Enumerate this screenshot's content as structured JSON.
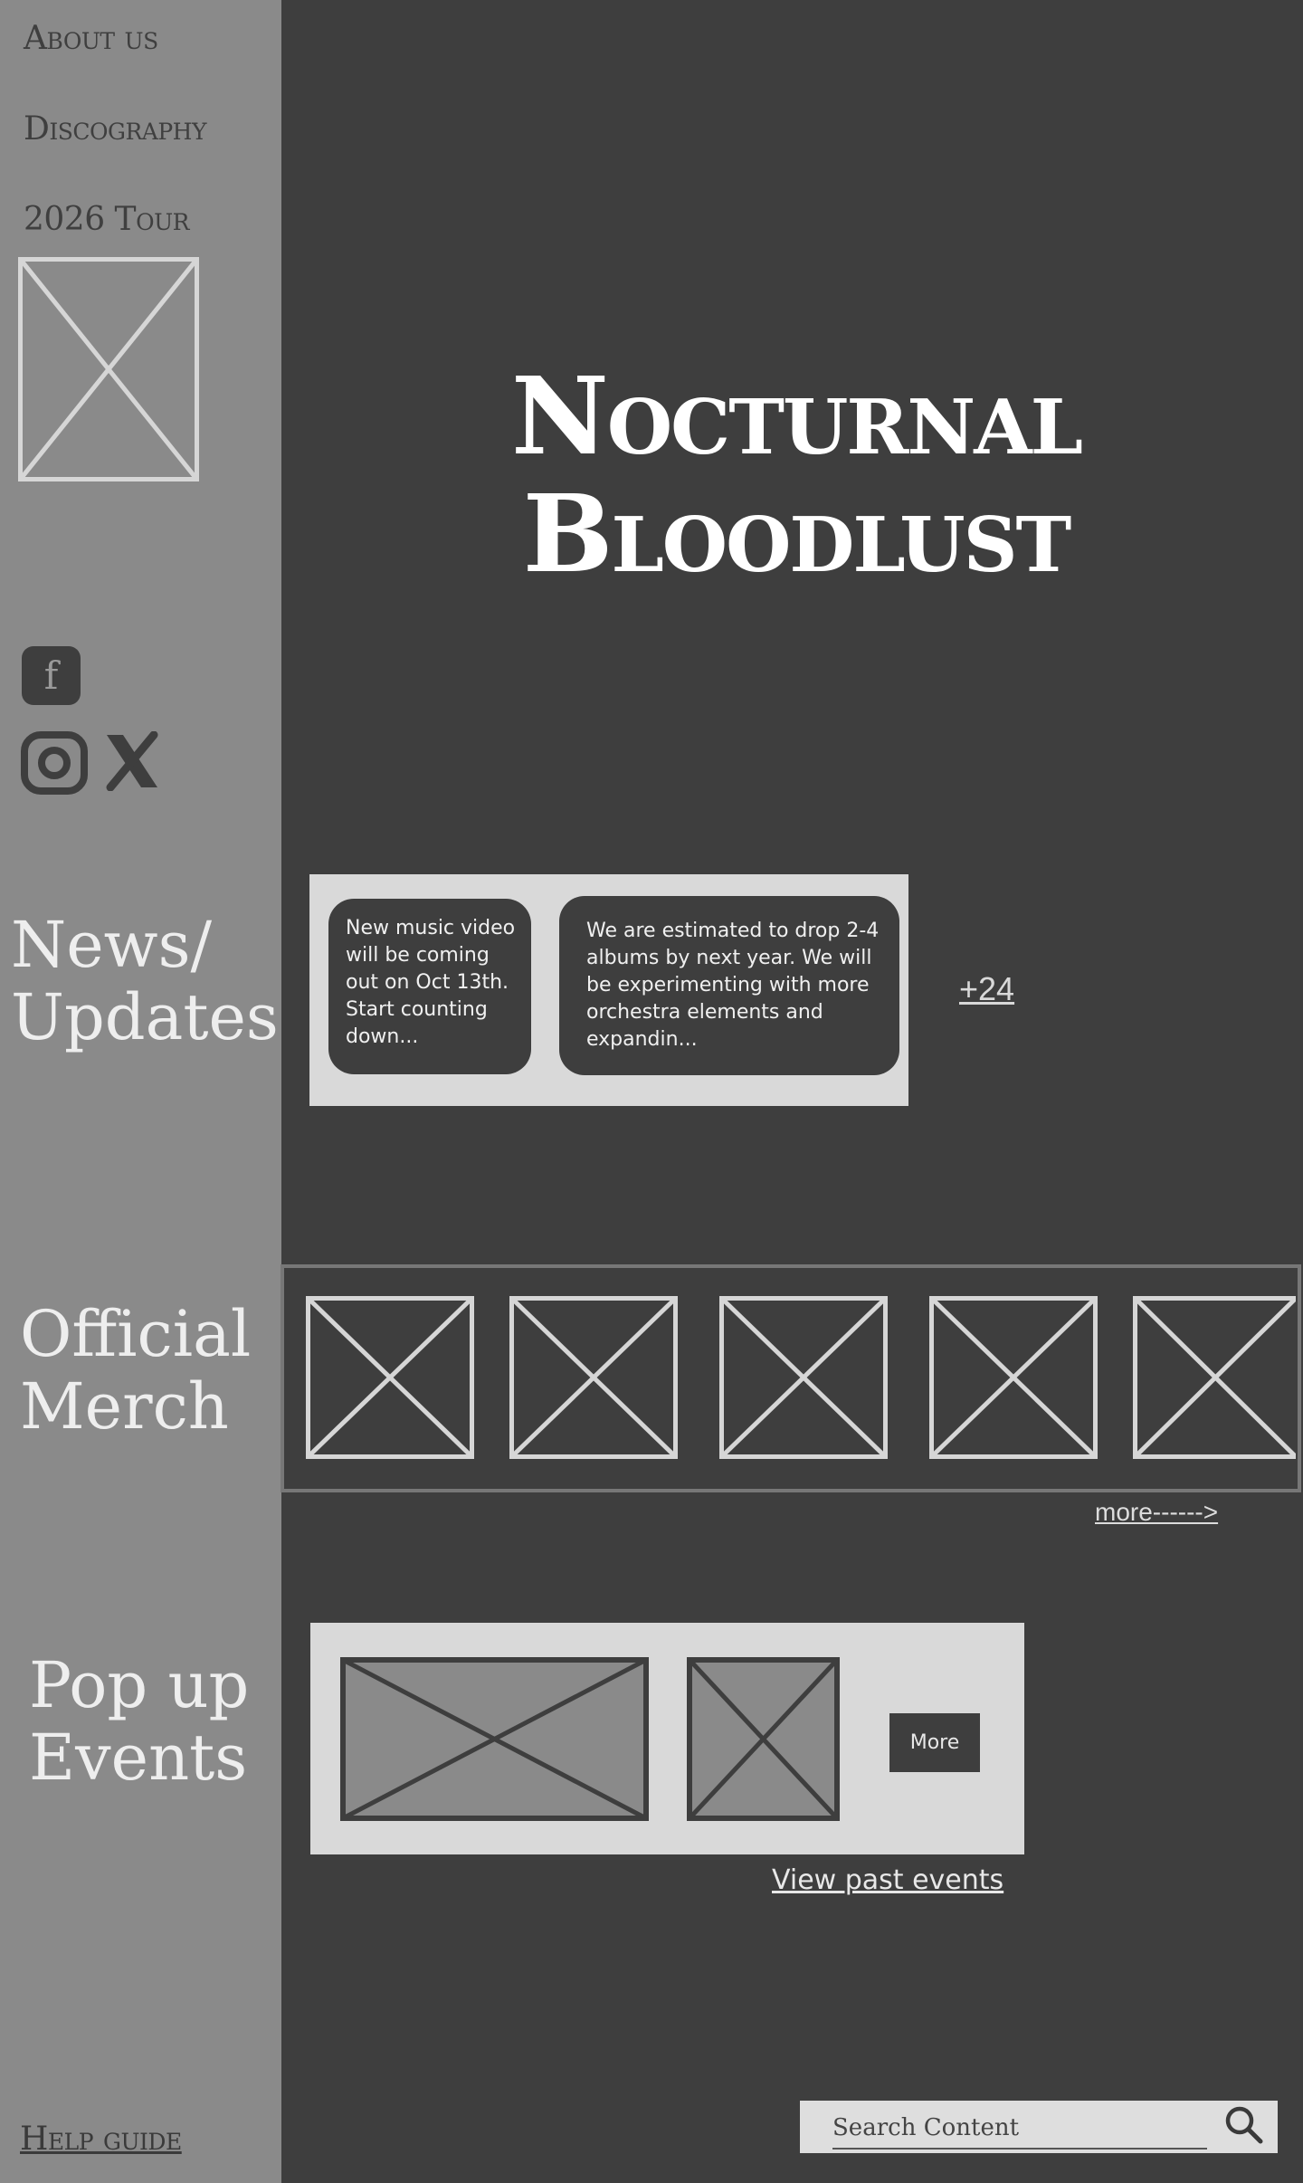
{
  "sidebar": {
    "nav": [
      {
        "label": "About us"
      },
      {
        "label": "Discography"
      },
      {
        "label": "2026 Tour"
      }
    ],
    "social": {
      "facebook_glyph": "f",
      "icons": [
        "facebook-icon",
        "instagram-icon",
        "x-icon"
      ]
    },
    "help_label": "Help guide"
  },
  "header": {
    "title": "Nocturnal Bloodlust"
  },
  "news": {
    "heading_line1": "News/",
    "heading_line2": "Updates",
    "items": [
      {
        "text": "New music video will be coming out on Oct 13th. Start counting down..."
      },
      {
        "text": "We are estimated to drop 2-4 albums by next year. We will be experimenting with more orchestra elements and expandin..."
      }
    ],
    "more_count": "+24"
  },
  "merch": {
    "heading_line1": "Official",
    "heading_line2": "Merch",
    "more_label": "more------>"
  },
  "popup": {
    "heading_line1": "Pop up",
    "heading_line2": "Events",
    "more_button": "More",
    "past_events_label": "View past events"
  },
  "search": {
    "placeholder": "Search Content"
  },
  "colors": {
    "background": "#3e3e3e",
    "sidebar": "#8a8a8a",
    "panel": "#d9d9d9",
    "text_light": "#ffffff"
  }
}
